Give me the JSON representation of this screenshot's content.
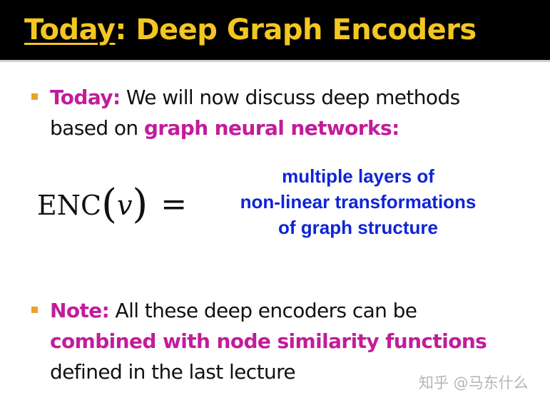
{
  "header": {
    "title_highlight": "Today",
    "title_rest": ": Deep Graph Encoders"
  },
  "bullets": [
    {
      "line1": {
        "lead": "Today:",
        "text": " We will now discuss deep methods"
      },
      "line2": {
        "text": "based on ",
        "emphasis": "graph neural networks:"
      }
    },
    {
      "line1": {
        "lead": "Note:",
        "text": " All these deep encoders can be"
      },
      "line2": {
        "emphasis": "combined with node similarity functions"
      },
      "line3": {
        "text": "defined in the last lecture"
      }
    }
  ],
  "formula": {
    "function": "ENC",
    "open_paren": "(",
    "variable": "v",
    "close_paren": ")",
    "equals": "="
  },
  "definition": {
    "lines": [
      "multiple layers of",
      "non-linear transformations",
      "of graph structure"
    ]
  },
  "watermark": {
    "text": "知乎 @马东什么"
  },
  "colors": {
    "header_background": "#000000",
    "title_color": "#f3c621",
    "bullet_color": "#e8a32a",
    "emphasis_color": "#c21c9b",
    "definition_color": "#0f24d6"
  }
}
